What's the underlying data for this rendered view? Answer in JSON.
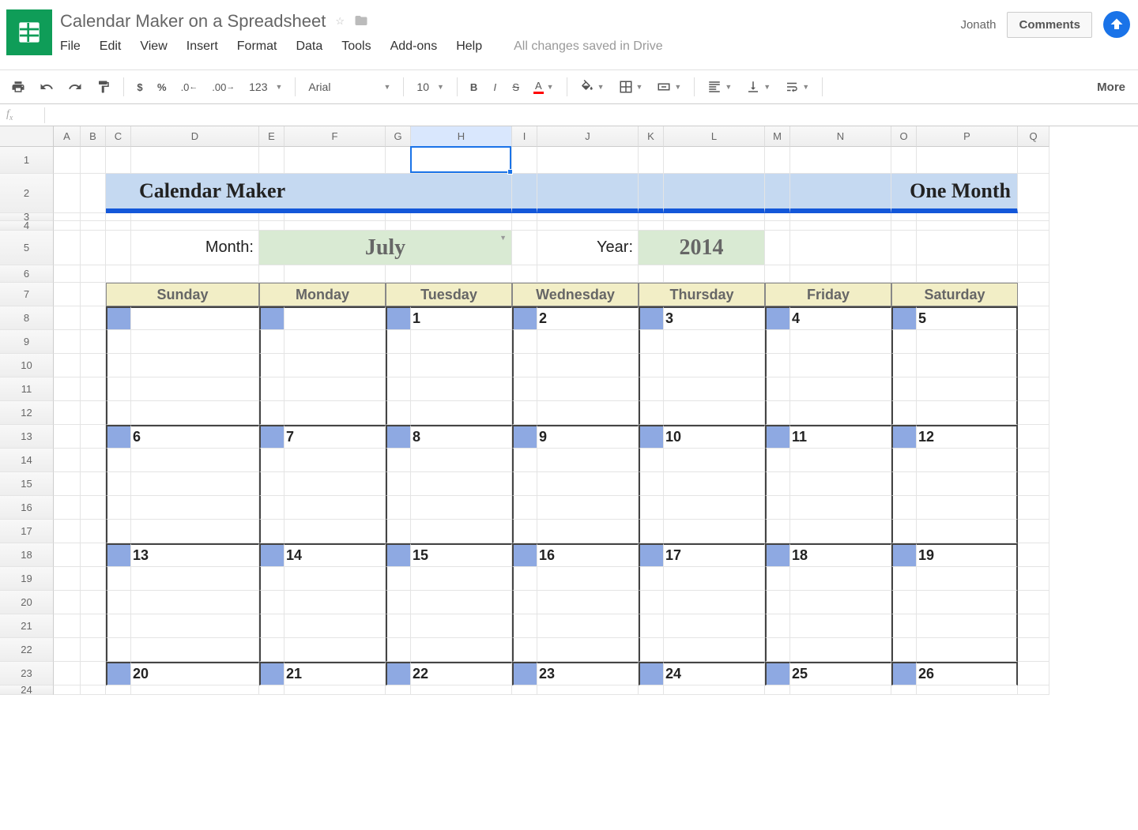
{
  "header": {
    "doc_title": "Calendar Maker on a Spreadsheet",
    "user": "Jonath",
    "comments_btn": "Comments"
  },
  "menubar": [
    "File",
    "Edit",
    "View",
    "Insert",
    "Format",
    "Data",
    "Tools",
    "Add-ons",
    "Help"
  ],
  "saved_text": "All changes saved in Drive",
  "toolbar": {
    "font": "Arial",
    "font_size": "10",
    "more": "More"
  },
  "formula_bar": {
    "fx": "fx"
  },
  "columns": [
    "A",
    "B",
    "C",
    "D",
    "E",
    "F",
    "G",
    "H",
    "I",
    "J",
    "K",
    "L",
    "M",
    "N",
    "O",
    "P",
    "Q"
  ],
  "selected_col": "H",
  "rows_visible": [
    "1",
    "2",
    "3",
    "4",
    "5",
    "6",
    "7",
    "8",
    "9",
    "10",
    "11",
    "12",
    "13",
    "14",
    "15",
    "16",
    "17",
    "18",
    "19",
    "20",
    "21",
    "22",
    "23",
    "24"
  ],
  "banner": {
    "left": "Calendar Maker",
    "right": "One Month"
  },
  "controls": {
    "month_label": "Month:",
    "month_value": "July",
    "year_label": "Year:",
    "year_value": "2014"
  },
  "weekdays": [
    "Sunday",
    "Monday",
    "Tuesday",
    "Wednesday",
    "Thursday",
    "Friday",
    "Saturday"
  ],
  "weeks": [
    [
      "",
      "",
      "1",
      "2",
      "3",
      "4",
      "5"
    ],
    [
      "6",
      "7",
      "8",
      "9",
      "10",
      "11",
      "12"
    ],
    [
      "13",
      "14",
      "15",
      "16",
      "17",
      "18",
      "19"
    ],
    [
      "20",
      "21",
      "22",
      "23",
      "24",
      "25",
      "26"
    ]
  ]
}
